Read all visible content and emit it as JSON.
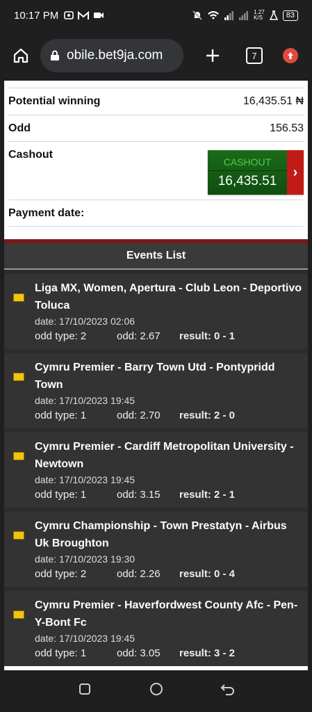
{
  "status_bar": {
    "time": "10:17 PM",
    "net_speed_top": "1.27",
    "net_speed_unit": "K/S",
    "battery": "83"
  },
  "browser": {
    "url": "obile.bet9ja.com",
    "tab_count": "7"
  },
  "details": {
    "potential_winning_label": "Potential winning",
    "potential_winning_value": "16,435.51 ₦",
    "odd_label": "Odd",
    "odd_value": "156.53",
    "cashout_label": "Cashout",
    "cashout_button_title": "CASHOUT",
    "cashout_button_value": "16,435.51",
    "payment_date_label": "Payment date:"
  },
  "events_header": "Events List",
  "events": [
    {
      "title": "Liga MX, Women, Apertura - Club Leon - Deportivo Toluca",
      "date": "date: 17/10/2023 02:06",
      "odd_type": "odd type: 2",
      "odd": "odd: 2.67",
      "result": "result: 0 - 1"
    },
    {
      "title": "Cymru Premier - Barry Town Utd - Pontypridd Town",
      "date": "date: 17/10/2023 19:45",
      "odd_type": "odd type: 1",
      "odd": "odd: 2.70",
      "result": "result: 2 - 0"
    },
    {
      "title": "Cymru Premier - Cardiff Metropolitan University - Newtown",
      "date": "date: 17/10/2023 19:45",
      "odd_type": "odd type: 1",
      "odd": "odd: 3.15",
      "result": "result: 2 - 1"
    },
    {
      "title": "Cymru Championship - Town Prestatyn - Airbus Uk Broughton",
      "date": "date: 17/10/2023 19:30",
      "odd_type": "odd type: 2",
      "odd": "odd: 2.26",
      "result": "result: 0 - 4"
    },
    {
      "title": "Cymru Premier - Haverfordwest County Afc - Pen-Y-Bont Fc",
      "date": "date: 17/10/2023 19:45",
      "odd_type": "odd type: 1",
      "odd": "odd: 3.05",
      "result": "result: 3 - 2"
    }
  ],
  "icons": {
    "home": "home-icon",
    "lock": "lock-icon",
    "new_tab": "plus-icon",
    "update": "update-icon",
    "flag": "flag-icon",
    "nav_recents": "recents-icon",
    "nav_home": "home-circle-icon",
    "nav_back": "back-icon"
  },
  "colors": {
    "cashout_green": "#1b6b1b",
    "cashout_red": "#c21b17",
    "events_bg": "#2c2c2c",
    "divider_red": "#7a1b1b"
  }
}
